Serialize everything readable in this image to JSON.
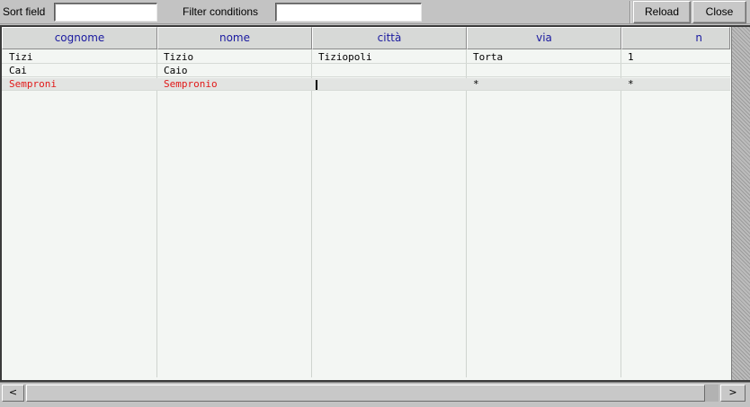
{
  "toolbar": {
    "sort_label": "Sort field",
    "sort_value": "",
    "filter_label": "Filter conditions",
    "filter_value": "",
    "reload_label": "Reload",
    "close_label": "Close"
  },
  "table": {
    "columns": [
      "cognome",
      "nome",
      "città",
      "via",
      "n"
    ],
    "rows": [
      {
        "cognome": "Tizi",
        "nome": "Tizio",
        "citta": "Tiziopoli",
        "via": "Torta",
        "n": "1"
      },
      {
        "cognome": "Cai",
        "nome": "Caio",
        "citta": "",
        "via": "",
        "n": ""
      },
      {
        "cognome": "Semproni",
        "nome": "Sempronio",
        "citta": "",
        "via": "*",
        "n": "*"
      }
    ]
  },
  "scrollbar": {
    "left_arrow": "<",
    "right_arrow": ">",
    "thumb_fraction": 0.98
  },
  "colors": {
    "header_text": "#1a1aa0",
    "edit_row_text": "#e11919",
    "grid_bg": "#f3f6f3",
    "chrome_bg": "#c3c3c3"
  }
}
